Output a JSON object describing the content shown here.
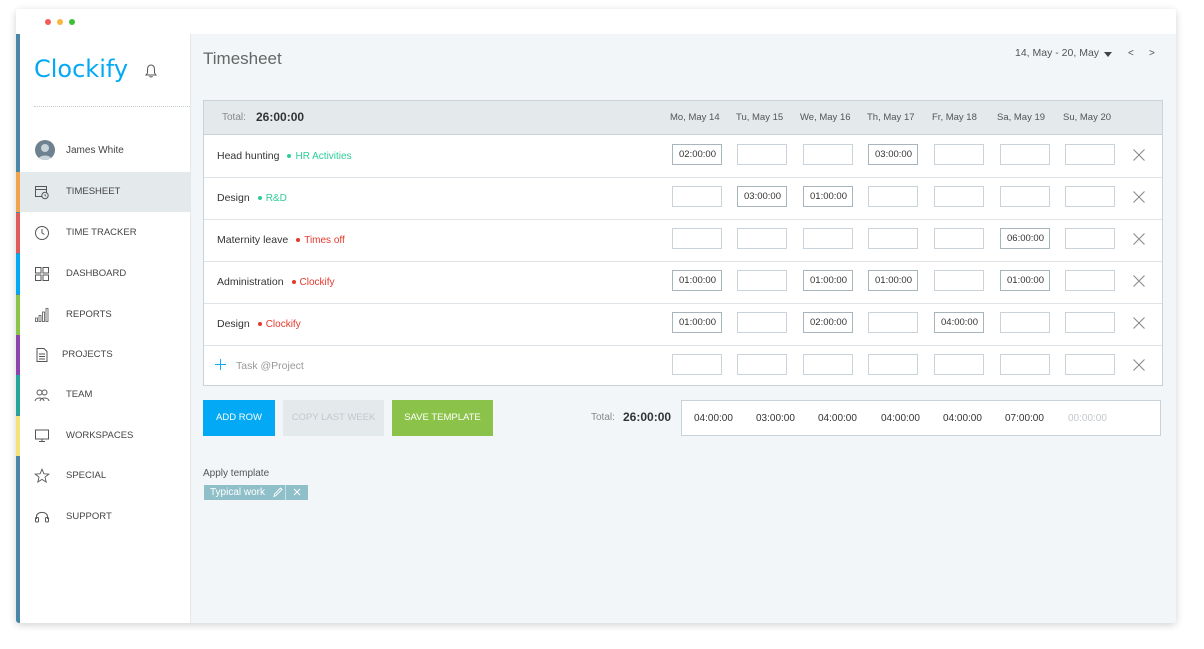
{
  "app": {
    "logo": "Clockify",
    "window_dots": [
      "#f25c54",
      "#f9b73b",
      "#3cc13b"
    ]
  },
  "sidebar": {
    "user": "James White",
    "items": [
      {
        "label": "TIMESHEET",
        "icon": "timesheet-calendar-icon",
        "color": "#f0a44d",
        "active": true
      },
      {
        "label": "TIME TRACKER",
        "icon": "clock-icon",
        "color": "#e05b5b"
      },
      {
        "label": "DASHBOARD",
        "icon": "dashboard-grid-icon",
        "color": "#03a9f4"
      },
      {
        "label": "REPORTS",
        "icon": "bar-chart-icon",
        "color": "#8bc34a"
      },
      {
        "label": "PROJECTS",
        "icon": "document-icon",
        "color": "#8e44ad"
      },
      {
        "label": "TEAM",
        "icon": "team-icon",
        "color": "#26a69a"
      },
      {
        "label": "WORKSPACES",
        "icon": "monitor-icon",
        "color": "#f5e27a"
      },
      {
        "label": "SPECIAL",
        "icon": "star-icon",
        "color": "#4a86a8"
      },
      {
        "label": "SUPPORT",
        "icon": "headset-icon",
        "color": "#4a86a8"
      }
    ]
  },
  "header": {
    "title": "Timesheet",
    "date_range": "14, May - 20, May",
    "prev": "<",
    "next": ">"
  },
  "grid": {
    "total_label": "Total:",
    "total_value": "26:00:00",
    "days": [
      "Mo, May 14",
      "Tu, May 15",
      "We, May 16",
      "Th, May 17",
      "Fr, May 18",
      "Sa, May 19",
      "Su, May 20"
    ],
    "rows": [
      {
        "task": "Head hunting",
        "project": "HR Activities",
        "color": "#2ecc9a",
        "cells": [
          "02:00:00",
          "",
          "",
          "03:00:00",
          "",
          "",
          ""
        ]
      },
      {
        "task": "Design",
        "project": "R&D",
        "color": "#2ecc9a",
        "cells": [
          "",
          "03:00:00",
          "01:00:00",
          "",
          "",
          "",
          ""
        ]
      },
      {
        "task": "Maternity leave",
        "project": "Times off",
        "color": "#e5392b",
        "cells": [
          "",
          "",
          "",
          "",
          "",
          "06:00:00",
          ""
        ]
      },
      {
        "task": "Administration",
        "project": "Clockify",
        "color": "#e5392b",
        "cells": [
          "01:00:00",
          "",
          "01:00:00",
          "01:00:00",
          "",
          "01:00:00",
          ""
        ]
      },
      {
        "task": "Design",
        "project": "Clockify",
        "color": "#e5392b",
        "cells": [
          "01:00:00",
          "",
          "02:00:00",
          "",
          "04:00:00",
          "",
          ""
        ]
      }
    ],
    "new_row_placeholder": "Task @Project"
  },
  "actions": {
    "add_row": "ADD ROW",
    "copy_last_week": "COPY LAST WEEK",
    "save_template": "SAVE TEMPLATE"
  },
  "footer": {
    "total_label": "Total:",
    "total_value": "26:00:00",
    "day_totals": [
      "04:00:00",
      "03:00:00",
      "04:00:00",
      "04:00:00",
      "04:00:00",
      "07:00:00",
      "00:00:00"
    ]
  },
  "templates": {
    "label": "Apply template",
    "chip": "Typical work"
  }
}
